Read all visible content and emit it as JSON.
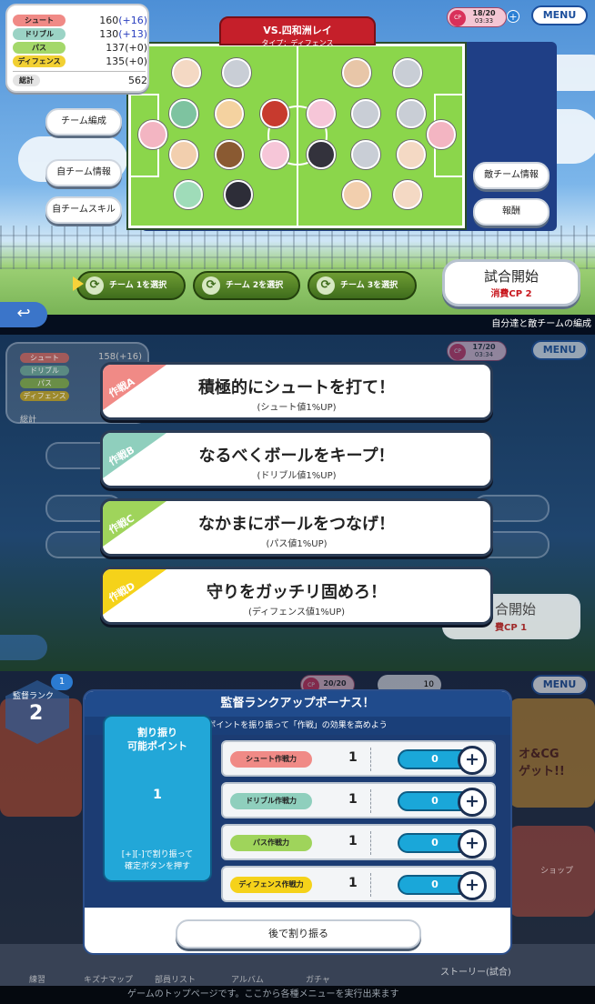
{
  "panel1": {
    "stats": [
      {
        "label": "シュート",
        "value": "160",
        "delta": "(+16)",
        "color": "#f08a86"
      },
      {
        "label": "ドリブル",
        "value": "130",
        "delta": "(+13)",
        "color": "#9bd3c5"
      },
      {
        "label": "パス",
        "value": "137",
        "delta": "(+0)",
        "color": "#a4d86a"
      },
      {
        "label": "ディフェンス",
        "value": "135",
        "delta": "(+0)",
        "color": "#f2d033"
      }
    ],
    "total_label": "総計",
    "total_value": "562",
    "vs_title": "VS.四和洲レイ",
    "vs_type": "タイプ：ディフェンス",
    "cp_label": "CP",
    "cp_value": "18/20",
    "cp_time": "03:33",
    "menu": "MENU",
    "left_buttons": [
      "チーム編成",
      "自チーム情報",
      "自チームスキル"
    ],
    "right_buttons": [
      "敵チーム情報",
      "報酬"
    ],
    "team_buttons": [
      "チーム 1を選択",
      "チーム 2を選択",
      "チーム 3を選択"
    ],
    "start_title": "試合開始",
    "start_cost": "消費CP 2",
    "caption": "自分達と敵チームの編成"
  },
  "panel2": {
    "stats": [
      {
        "label": "シュート",
        "value": "158(+16)"
      },
      {
        "label": "ドリブル",
        "value": ""
      },
      {
        "label": "パス",
        "value": ""
      },
      {
        "label": "ディフェンス",
        "value": ""
      }
    ],
    "total_label": "総計",
    "cp_value": "17/20",
    "cp_time": "03:34",
    "menu": "MENU",
    "start_title": "合開始",
    "start_cost": "費CP 1",
    "tactics": [
      {
        "tag": "作戦A",
        "title": "積極的にシュートを打て！",
        "sub": "(シュート値1%UP)",
        "color": "#f08a86"
      },
      {
        "tag": "作戦B",
        "title": "なるべくボールをキープ！",
        "sub": "(ドリブル値1%UP)",
        "color": "#8fcfbd"
      },
      {
        "tag": "作戦C",
        "title": "なかまにボールをつなげ！",
        "sub": "(パス値1%UP)",
        "color": "#9fd45b"
      },
      {
        "tag": "作戦D",
        "title": "守りをガッチリ固めろ！",
        "sub": "(ディフェンス値1%UP)",
        "color": "#f5d21a"
      }
    ]
  },
  "panel3": {
    "rank_label": "監督ランク",
    "rank_value": "2",
    "rank_badge": "1",
    "cp_value": "20/20",
    "coins": "10",
    "menu": "MENU",
    "dialog_title": "監督ランクアップボーナス！",
    "dialog_sub": "ポイントを振り振って「作戦」の効果を高めよう",
    "points_title": "割り振り\n可能ポイント",
    "points_value": "1",
    "points_note": "[+][-]で割り振って\n確定ボタンを押す",
    "rows": [
      {
        "label": "シュート作戦力",
        "level": "1",
        "alloc": "0",
        "color": "#f08a86"
      },
      {
        "label": "ドリブル作戦力",
        "level": "1",
        "alloc": "0",
        "color": "#8fcfbd"
      },
      {
        "label": "パス作戦力",
        "level": "1",
        "alloc": "0",
        "color": "#9fd45b"
      },
      {
        "label": "ディフェンス作戦力",
        "level": "1",
        "alloc": "0",
        "color": "#f5d21a"
      }
    ],
    "later_button": "後で割り振る",
    "bottom_tabs": [
      "練習",
      "キズナマップ",
      "部員リスト",
      "アルバム",
      "ガチャ"
    ],
    "story": "ストーリー(試合)",
    "shop": "ショップ",
    "banner": "オ&CG\nゲット!!",
    "footer": "ゲームのトップページです。ここから各種メニューを実行出来ます"
  }
}
